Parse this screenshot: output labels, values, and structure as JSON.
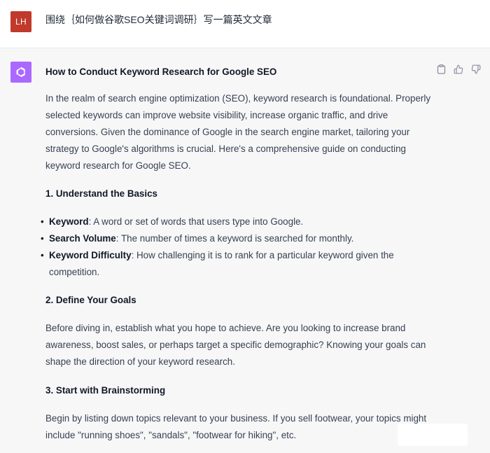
{
  "user_message": {
    "avatar_initials": "LH",
    "text": "围绕｛如何做谷歌SEO关键词调研｝写一篇英文文章"
  },
  "assistant_message": {
    "title": "How to Conduct Keyword Research for Google SEO",
    "intro": "In the realm of search engine optimization (SEO), keyword research is foundational. Properly selected keywords can improve website visibility, increase organic traffic, and drive conversions. Given the dominance of Google in the search engine market, tailoring your strategy to Google's algorithms is crucial. Here's a comprehensive guide on conducting keyword research for Google SEO.",
    "section1_heading": "1. Understand the Basics",
    "bullets": [
      {
        "term": "Keyword",
        "desc": ": A word or set of words that users type into Google."
      },
      {
        "term": "Search Volume",
        "desc": ": The number of times a keyword is searched for monthly."
      },
      {
        "term": "Keyword Difficulty",
        "desc": ": How challenging it is to rank for a particular keyword given the competition."
      }
    ],
    "section2_heading": "2. Define Your Goals",
    "section2_text": "Before diving in, establish what you hope to achieve. Are you looking to increase brand awareness, boost sales, or perhaps target a specific demographic? Knowing your goals can shape the direction of your keyword research.",
    "section3_heading": "3. Start with Brainstorming",
    "section3_text": "Begin by listing down topics relevant to your business. If you sell footwear, your topics might include \"running shoes\", \"sandals\", \"footwear for hiking\", etc."
  },
  "actions": {
    "copy_icon": "clipboard-icon",
    "like_icon": "thumbs-up-icon",
    "dislike_icon": "thumbs-down-icon"
  },
  "colors": {
    "user_avatar_bg": "#c0392b",
    "assistant_avatar_bg": "#ab68ff",
    "assistant_bg": "#f7f7f8"
  }
}
